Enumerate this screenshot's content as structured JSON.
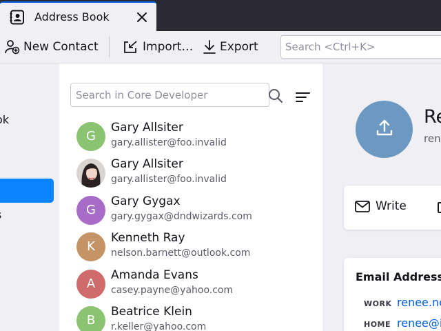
{
  "tab": {
    "title": "Address Book"
  },
  "toolbar": {
    "new_contact": "New Contact",
    "import": "Import…",
    "export": "Export",
    "search_placeholder": "Search <Ctrl+K>"
  },
  "books": {
    "items": [
      {
        "label": "ok"
      },
      {
        "label": "s"
      }
    ]
  },
  "list": {
    "search_placeholder": "Search in Core Developer",
    "contacts": [
      {
        "initial": "G",
        "name": "Gary Allsiter",
        "email": "gary.allister@foo.invalid",
        "color": "#8bc471",
        "photo": false
      },
      {
        "initial": "",
        "name": "Gary Allsiter",
        "email": "gary.allister@foo.invalid",
        "color": "#3a3030",
        "photo": true
      },
      {
        "initial": "G",
        "name": "Gary Gygax",
        "email": "gary.gygax@dndwizards.com",
        "color": "#a66cc8",
        "photo": false
      },
      {
        "initial": "K",
        "name": "Kenneth Ray",
        "email": "nelson.barnett@outlook.com",
        "color": "#c49466",
        "photo": false
      },
      {
        "initial": "A",
        "name": "Amanda Evans",
        "email": "casey.payne@yahoo.com",
        "color": "#cf6b6b",
        "photo": false
      },
      {
        "initial": "B",
        "name": "Beatrice Klein",
        "email": "r.keller@yahoo.com",
        "color": "#8bc471",
        "photo": false
      }
    ]
  },
  "detail": {
    "name": "Re",
    "subtitle": "ren",
    "write_label": "Write",
    "emails_heading": "Email Addresses",
    "emails": [
      {
        "label": "WORK",
        "value": "renee.ne"
      },
      {
        "label": "HOME",
        "value": "renee@i"
      }
    ]
  }
}
